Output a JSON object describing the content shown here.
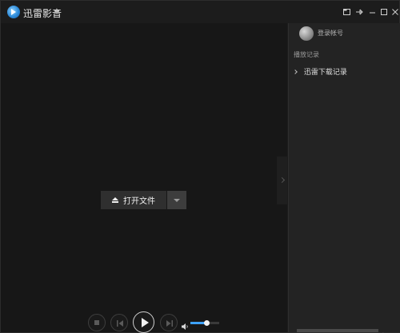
{
  "window": {
    "title": "迅雷影音",
    "controls": [
      "minimize-to-tray-icon",
      "pin-icon",
      "minimize-icon",
      "maximize-icon",
      "close-icon"
    ]
  },
  "main": {
    "open_file_label": "打开文件"
  },
  "playback": {
    "volume_level": 0.55,
    "accent_color": "#3ea2ff"
  },
  "sidebar": {
    "login_label": "登录帐号",
    "history_heading": "播放记录",
    "history_items": [
      {
        "label": "迅雷下载记录"
      }
    ]
  }
}
